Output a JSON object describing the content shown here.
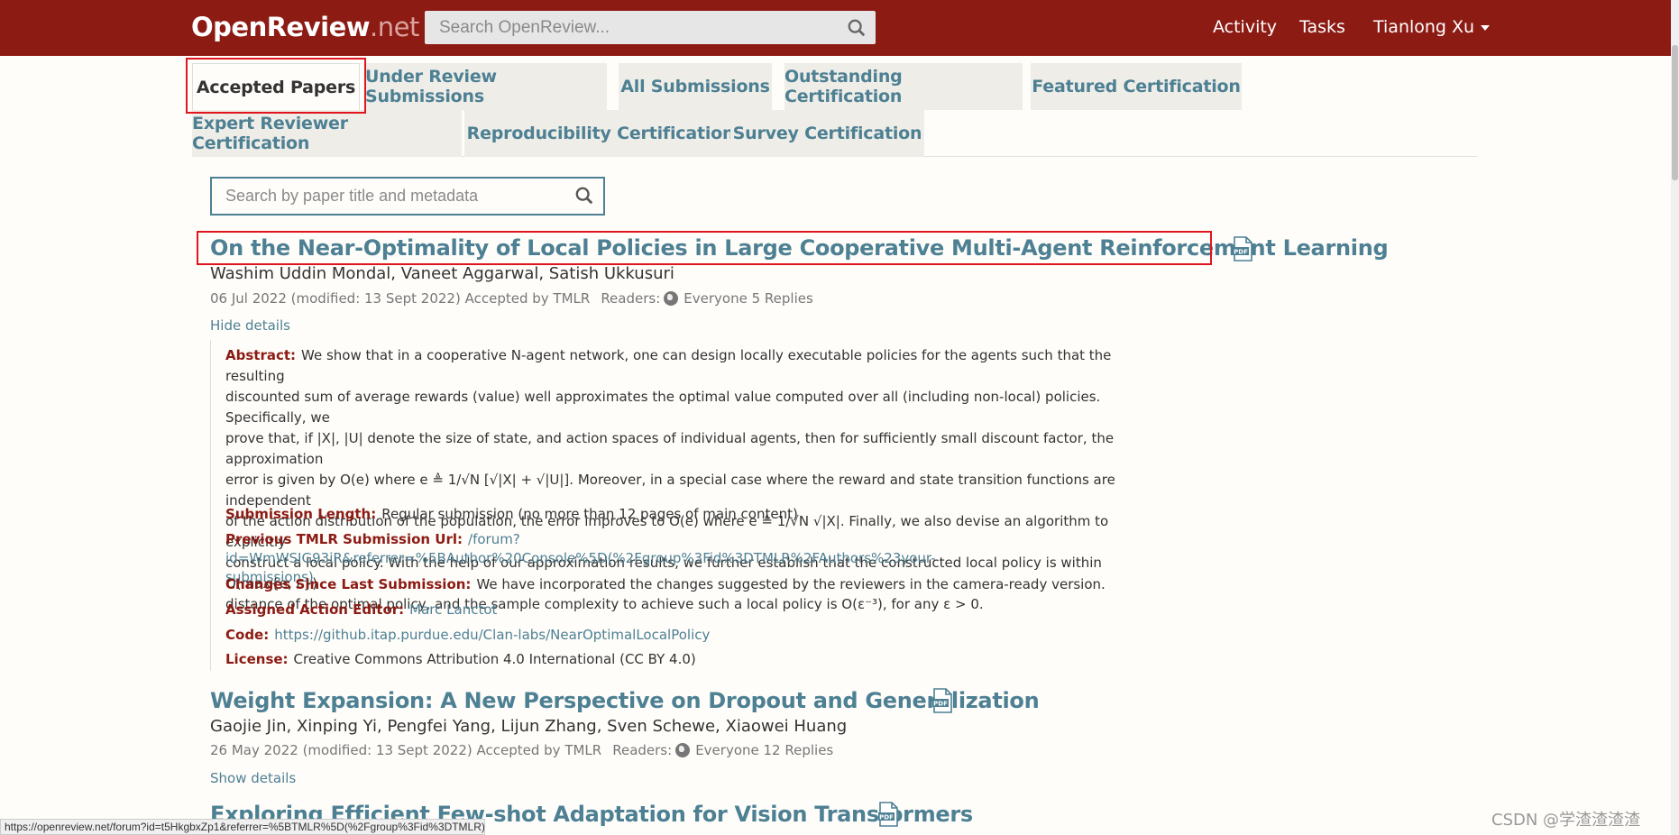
{
  "navbar": {
    "brand_main": "OpenReview",
    "brand_suffix": ".net",
    "search_placeholder": "Search OpenReview...",
    "links": {
      "activity": "Activity",
      "tasks": "Tasks",
      "user": "Tianlong Xu"
    }
  },
  "tabs": [
    {
      "label": "Accepted Papers"
    },
    {
      "label": "Under Review Submissions"
    },
    {
      "label": "All Submissions"
    },
    {
      "label": "Outstanding Certification"
    },
    {
      "label": "Featured Certification"
    },
    {
      "label": "Expert Reviewer Certification"
    },
    {
      "label": "Reproducibility Certification"
    },
    {
      "label": "Survey Certification"
    }
  ],
  "filter": {
    "placeholder": "Search by paper title and metadata"
  },
  "notes": [
    {
      "title": "On the Near-Optimality of Local Policies in Large Cooperative Multi-Agent Reinforcement Learning",
      "authors": "Washim Uddin Mondal, Vaneet Aggarwal, Satish Ukkusuri",
      "date": "06 Jul 2022 (modified: 13 Sept 2022)",
      "venue": "Accepted by TMLR",
      "readers_label": "Readers:",
      "readers": "Everyone",
      "replies": "5 Replies",
      "details_toggle": "Hide details",
      "abstract_label": "Abstract:",
      "abstract_lines": [
        "We show that in a cooperative N-agent network, one can design locally executable policies for the agents such that the resulting",
        "discounted sum of average rewards (value) well approximates the optimal value computed over all (including non-local) policies. Specifically, we",
        "prove that, if |X|, |U| denote the size of state, and action spaces of individual agents, then for sufficiently small discount factor, the approximation",
        "error is given by O(e) where e ≜ 1/√N [√|X| + √|U|]. Moreover, in a special case where the reward and state transition functions are independent",
        "of the action distribution of the population, the error improves to O(e) where e ≜ 1/√N √|X|. Finally, we also devise an algorithm to explicitly",
        "construct a local policy. With the help of our approximation results, we further establish that the constructed local policy is within O(max{e, ε})",
        "distance of the optimal policy, and the sample complexity to achieve such a local policy is O(ε⁻³), for any ε > 0."
      ],
      "submission_length_label": "Submission Length:",
      "submission_length": "Regular submission (no more than 12 pages of main content)",
      "previous_url_label": "Previous TMLR Submission Url:",
      "previous_url_line1": "/forum?id=WmWSIG93iR&referrer=%5BAuthor%20Console%5D(%2Fgroup%3Fid%3DTMLR%2FAuthors%23your-",
      "previous_url_line2": "submissions)",
      "changes_label": "Changes Since Last Submission:",
      "changes": "We have incorporated the changes suggested by the reviewers in the camera-ready version.",
      "action_editor_label": "Assigned Action Editor:",
      "action_editor": "Marc Lanctot",
      "code_label": "Code:",
      "code": "https://github.itap.purdue.edu/Clan-labs/NearOptimalLocalPolicy",
      "license_label": "License:",
      "license": "Creative Commons Attribution 4.0 International (CC BY 4.0)"
    },
    {
      "title": "Weight Expansion: A New Perspective on Dropout and Generalization",
      "authors": "Gaojie Jin, Xinping Yi, Pengfei Yang, Lijun Zhang, Sven Schewe, Xiaowei Huang",
      "date": "26 May 2022 (modified: 13 Sept 2022)",
      "venue": "Accepted by TMLR",
      "readers_label": "Readers:",
      "readers": "Everyone",
      "replies": "12 Replies",
      "details_toggle": "Show details"
    },
    {
      "title": "Exploring Efficient Few-shot Adaptation for Vision Transformers"
    }
  ],
  "statusbar": "https://openreview.net/forum?id=t5HkgbxZp1&referrer=%5BTMLR%5D(%2Fgroup%3Fid%3DTMLR)",
  "watermark": "CSDN @学渣渣渣渣",
  "colors": {
    "navbar": "#8c1b13",
    "link": "#4d8093",
    "label": "#8c1b13",
    "highlight": "#e0161e"
  }
}
